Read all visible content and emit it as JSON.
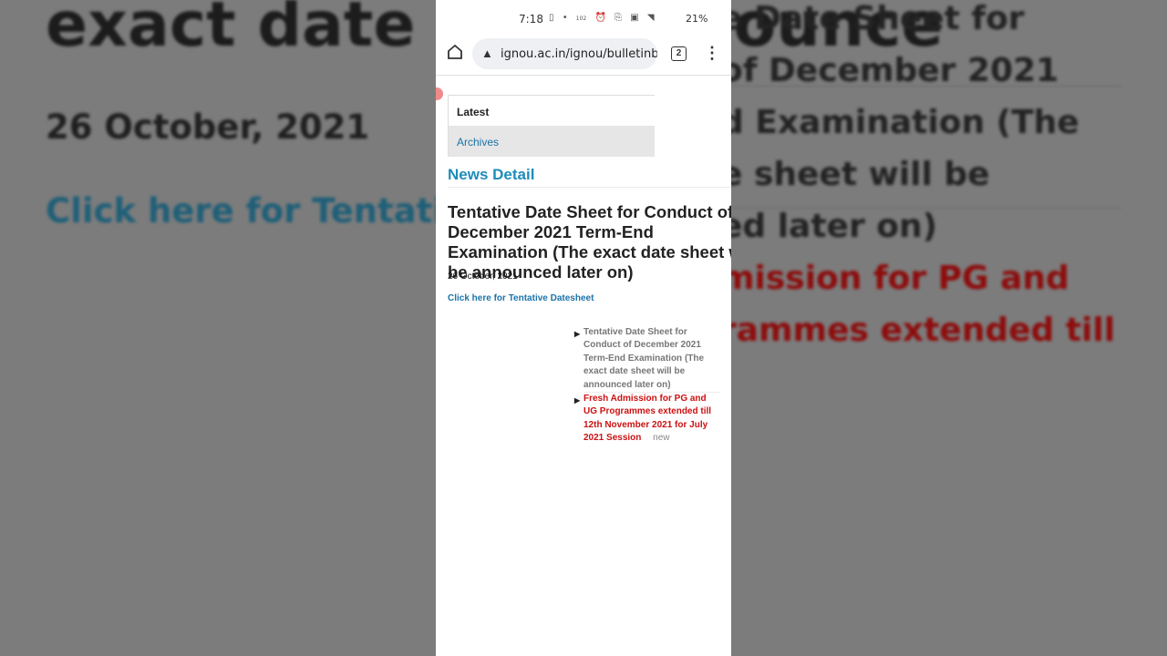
{
  "background": {
    "title": "exact date s      be announce",
    "date": "26 October, 2021",
    "link": "Click here for Tentative",
    "side_lines": [
      "e Date Sheet for",
      "of December 2021",
      "d Examination (The",
      "e sheet will be",
      "ed later on)"
    ],
    "side_red_lines": [
      "mission for PG and",
      "rammes extended till"
    ]
  },
  "status_bar": {
    "time": "7:18",
    "icons": [
      "sim-icon",
      "dot-icon",
      "speed-icon",
      "alarm-icon",
      "cast-icon",
      "volte-icon",
      "wifi-icon",
      "signal-icon"
    ],
    "speed": "102 KB/S",
    "network": "VoWiFi",
    "battery": "21%"
  },
  "browser": {
    "url": "ignou.ac.in/ignou/bulletinbo",
    "tab_count": "2"
  },
  "page": {
    "tabs": [
      {
        "label": "Latest"
      },
      {
        "label": "Archives"
      }
    ],
    "section_title": "News Detail",
    "article": {
      "title": "Tentative Date Sheet for Conduct of December 2021 Term-End Examination (The exact date sheet will be announced later on)",
      "date": "26 October, 2021",
      "link_label": "Click here for Tentative Datesheet"
    },
    "side_news": [
      {
        "label": "Tentative Date Sheet for Conduct of December 2021 Term-End Examination (The exact date sheet will be announced later on)"
      },
      {
        "label": "Fresh Admission for PG and UG Programmes extended till 12th November 2021 for July 2021 Session",
        "badge": "new"
      }
    ]
  },
  "colors": {
    "link_blue": "#1b73a8",
    "heading_blue": "#1e8cba",
    "alert_red": "#cc1111"
  }
}
